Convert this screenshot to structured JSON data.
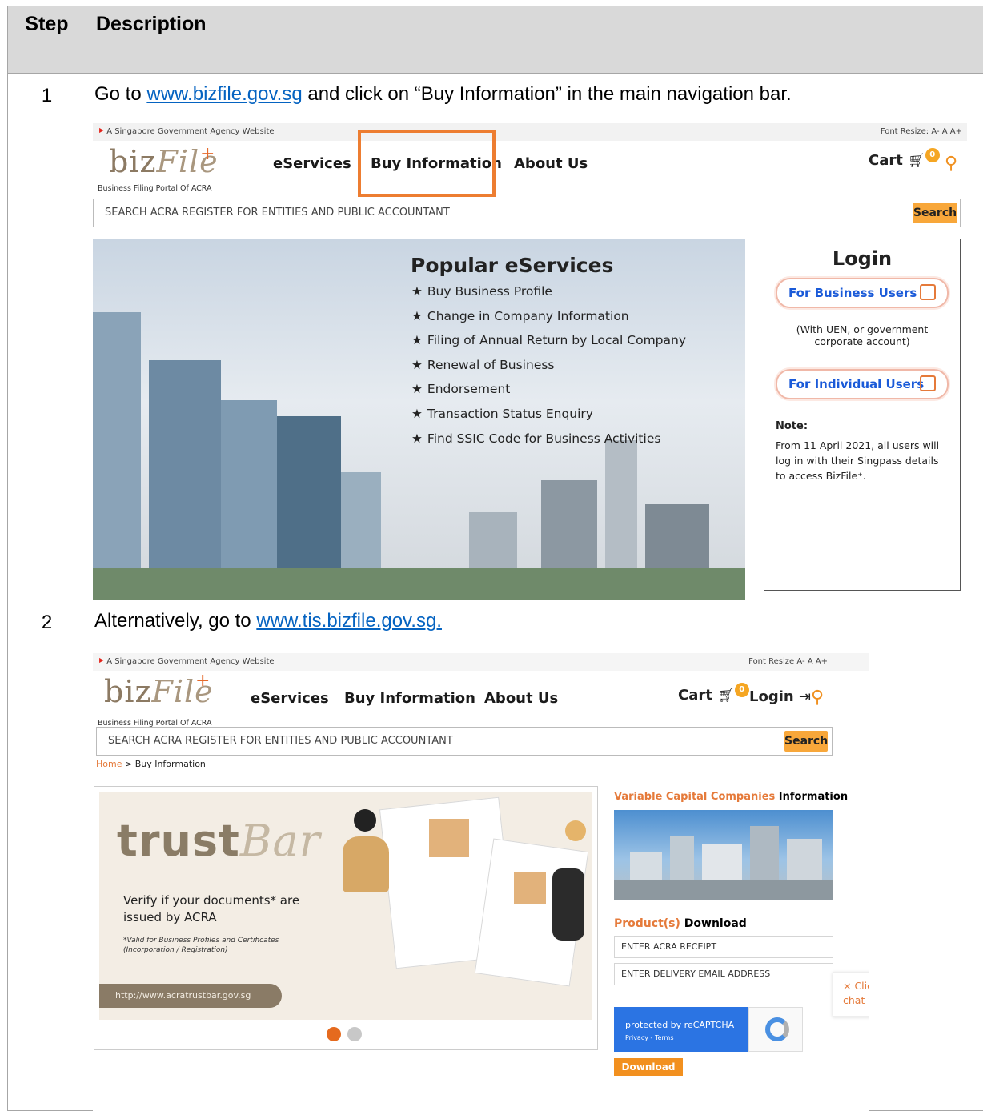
{
  "table": {
    "header_step": "Step",
    "header_description": "Description"
  },
  "rows": [
    {
      "step": "1",
      "text_before": "Go to ",
      "link": "www.bizfile.gov.sg",
      "text_after": " and click on “Buy Information” in the main navigation bar."
    },
    {
      "step": "2",
      "text_before": "Alternatively, go to ",
      "link": "www.tis.bizfile.gov.sg.",
      "text_after": ""
    }
  ],
  "shot1": {
    "gov_banner": "A Singapore Government Agency Website",
    "font_resize": "Font Resize: A- A A+",
    "logo_tagline": "Business Filing Portal Of ACRA",
    "nav": [
      "eServices",
      "Buy Information",
      "About Us"
    ],
    "cart_label": "Cart",
    "cart_count": "0",
    "search_placeholder": "SEARCH ACRA REGISTER FOR ENTITIES AND PUBLIC ACCOUNTANT",
    "search_button": "Search",
    "popular_title": "Popular eServices",
    "popular_items": [
      "Buy Business Profile",
      "Change in Company Information",
      "Filing of Annual Return by Local Company",
      "Renewal of Business",
      "Endorsement",
      "Transaction Status Enquiry",
      "Find SSIC Code for Business Activities"
    ],
    "login_title": "Login",
    "login_business": "For Business Users",
    "login_business_note": "(With UEN, or government corporate account)",
    "login_individual": "For Individual Users",
    "note_head": "Note:",
    "note_body": "From 11 April 2021, all users will log in with their Singpass details to access BizFile⁺.",
    "highlight_color": "#ed7d31"
  },
  "shot2": {
    "gov_banner": "A Singapore Government Agency Website",
    "font_resize": "Font Resize A- A A+",
    "logo_tagline": "Business Filing Portal Of ACRA",
    "nav": [
      "eServices",
      "Buy Information",
      "About Us"
    ],
    "cart_label": "Cart",
    "cart_count": "0",
    "login_label": "Login",
    "search_placeholder": "SEARCH ACRA REGISTER FOR ENTITIES AND PUBLIC ACCOUNTANT",
    "search_button": "Search",
    "breadcrumb_home": "Home",
    "breadcrumb_current": " > Buy Information",
    "banner_text": "Verify if your documents* are issued by ACRA",
    "banner_small": "*Valid for Business Profiles and Certificates (Incorporation / Registration)",
    "banner_url": "http://www.acratrustbar.gov.sg",
    "vcc_orange": "Variable Capital Companies",
    "vcc_black": " Information",
    "product_orange": "Product(s)",
    "product_black": " Download",
    "receipt_placeholder": "ENTER ACRA RECEIPT",
    "email_placeholder": "ENTER DELIVERY EMAIL ADDRESS",
    "captcha_text": "protected by reCAPTCHA",
    "captcha_links": "Privacy - Terms",
    "download_button": "Download",
    "chat_text": "Click here to chat with me."
  }
}
